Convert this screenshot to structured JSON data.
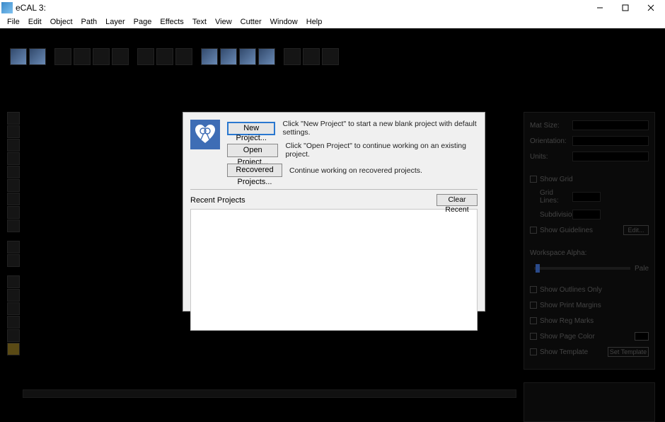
{
  "title": "eCAL 3:",
  "menu": [
    "File",
    "Edit",
    "Object",
    "Path",
    "Layer",
    "Page",
    "Effects",
    "Text",
    "View",
    "Cutter",
    "Window",
    "Help"
  ],
  "dialog": {
    "buttons": {
      "new": "New Project...",
      "open": "Open Project...",
      "recovered": "Recovered Projects..."
    },
    "descriptions": {
      "new": "Click \"New Project\" to start a new blank project with default settings.",
      "open": "Click \"Open Project\" to continue working on an existing project.",
      "recovered": "Continue working on recovered projects."
    },
    "recent_label": "Recent Projects",
    "clear_label": "Clear Recent"
  },
  "panel": {
    "mat_size": "Mat Size:",
    "orientation": "Orientation:",
    "units": "Units:",
    "show_grid": "Show Grid",
    "grid_lines": "Grid Lines:",
    "subdivision": "Subdivision:",
    "show_guidelines": "Show Guidelines",
    "edit": "Edit...",
    "workspace_alpha": "Workspace Alpha:",
    "alpha_value": "Pale",
    "show_outlines": "Show Outlines Only",
    "show_margins": "Show Print Margins",
    "show_reg": "Show Reg Marks",
    "show_page_color": "Show Page Color",
    "show_template": "Show Template",
    "set_template": "Set Template"
  }
}
